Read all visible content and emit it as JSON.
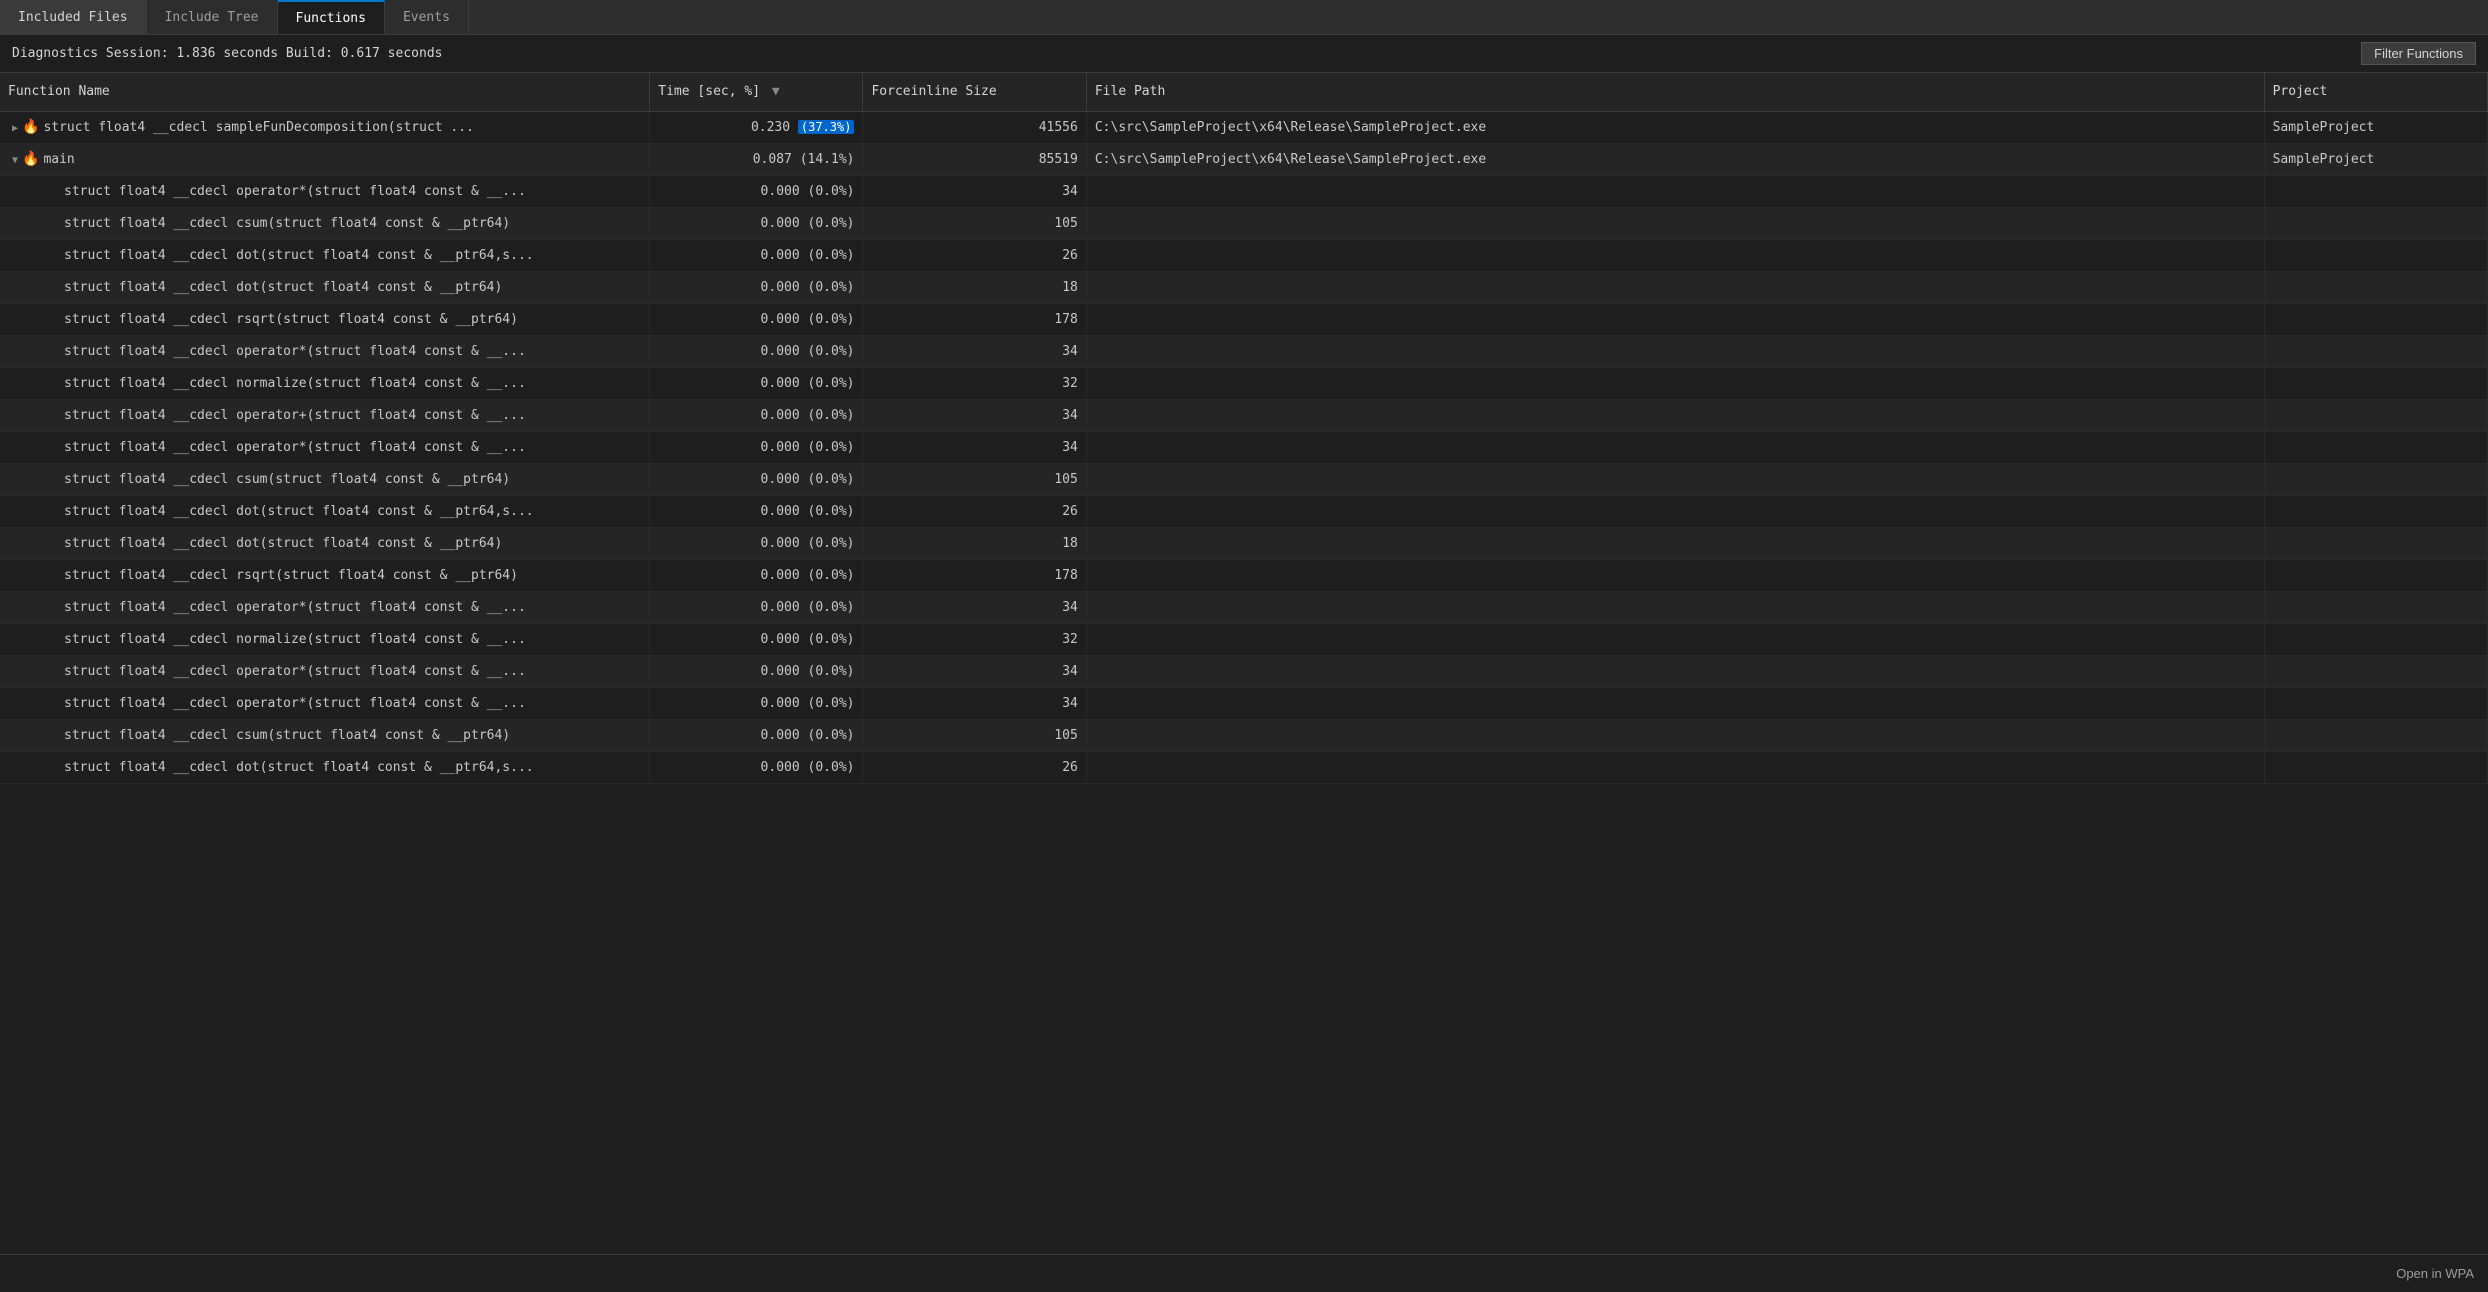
{
  "tabs": [
    {
      "id": "included-files",
      "label": "Included Files",
      "active": false
    },
    {
      "id": "include-tree",
      "label": "Include Tree",
      "active": false
    },
    {
      "id": "functions",
      "label": "Functions",
      "active": true
    },
    {
      "id": "events",
      "label": "Events",
      "active": false
    }
  ],
  "status": {
    "text": "Diagnostics Session: 1.836 seconds  Build: 0.617 seconds"
  },
  "filter_button_label": "Filter Functions",
  "open_wpa_label": "Open in WPA",
  "columns": {
    "name": "Function Name",
    "time": "Time [sec, %]",
    "force": "Forceinline Size",
    "path": "File Path",
    "project": "Project"
  },
  "rows": [
    {
      "indent": 0,
      "expandable": true,
      "expanded": false,
      "has_fire": true,
      "name": "struct float4 __cdecl sampleFunDecomposition(struct ...",
      "time_val": "0.230",
      "time_pct": "37.3%",
      "time_pct_highlight": true,
      "force": "41556",
      "path": "C:\\src\\SampleProject\\x64\\Release\\SampleProject.exe",
      "project": "SampleProject"
    },
    {
      "indent": 0,
      "expandable": true,
      "expanded": true,
      "has_fire": true,
      "name": "main",
      "time_val": "0.087",
      "time_pct": "14.1%",
      "time_pct_highlight": false,
      "force": "85519",
      "path": "C:\\src\\SampleProject\\x64\\Release\\SampleProject.exe",
      "project": "SampleProject"
    },
    {
      "indent": 1,
      "expandable": false,
      "expanded": false,
      "has_fire": false,
      "name": "struct float4 __cdecl operator*(struct float4 const & __...",
      "time_val": "0.000",
      "time_pct": "0.0%",
      "time_pct_highlight": false,
      "force": "34",
      "path": "",
      "project": ""
    },
    {
      "indent": 1,
      "expandable": false,
      "expanded": false,
      "has_fire": false,
      "name": "struct float4 __cdecl csum(struct float4 const & __ptr64)",
      "time_val": "0.000",
      "time_pct": "0.0%",
      "time_pct_highlight": false,
      "force": "105",
      "path": "",
      "project": ""
    },
    {
      "indent": 1,
      "expandable": false,
      "expanded": false,
      "has_fire": false,
      "name": "struct float4 __cdecl dot(struct float4 const & __ptr64,s...",
      "time_val": "0.000",
      "time_pct": "0.0%",
      "time_pct_highlight": false,
      "force": "26",
      "path": "",
      "project": ""
    },
    {
      "indent": 1,
      "expandable": false,
      "expanded": false,
      "has_fire": false,
      "name": "struct float4 __cdecl dot(struct float4 const & __ptr64)",
      "time_val": "0.000",
      "time_pct": "0.0%",
      "time_pct_highlight": false,
      "force": "18",
      "path": "",
      "project": ""
    },
    {
      "indent": 1,
      "expandable": false,
      "expanded": false,
      "has_fire": false,
      "name": "struct float4 __cdecl rsqrt(struct float4 const & __ptr64)",
      "time_val": "0.000",
      "time_pct": "0.0%",
      "time_pct_highlight": false,
      "force": "178",
      "path": "",
      "project": ""
    },
    {
      "indent": 1,
      "expandable": false,
      "expanded": false,
      "has_fire": false,
      "name": "struct float4 __cdecl operator*(struct float4 const & __...",
      "time_val": "0.000",
      "time_pct": "0.0%",
      "time_pct_highlight": false,
      "force": "34",
      "path": "",
      "project": ""
    },
    {
      "indent": 1,
      "expandable": false,
      "expanded": false,
      "has_fire": false,
      "name": "struct float4 __cdecl normalize(struct float4 const & __...",
      "time_val": "0.000",
      "time_pct": "0.0%",
      "time_pct_highlight": false,
      "force": "32",
      "path": "",
      "project": ""
    },
    {
      "indent": 1,
      "expandable": false,
      "expanded": false,
      "has_fire": false,
      "name": "struct float4 __cdecl operator+(struct float4 const & __...",
      "time_val": "0.000",
      "time_pct": "0.0%",
      "time_pct_highlight": false,
      "force": "34",
      "path": "",
      "project": ""
    },
    {
      "indent": 1,
      "expandable": false,
      "expanded": false,
      "has_fire": false,
      "name": "struct float4 __cdecl operator*(struct float4 const & __...",
      "time_val": "0.000",
      "time_pct": "0.0%",
      "time_pct_highlight": false,
      "force": "34",
      "path": "",
      "project": ""
    },
    {
      "indent": 1,
      "expandable": false,
      "expanded": false,
      "has_fire": false,
      "name": "struct float4 __cdecl csum(struct float4 const & __ptr64)",
      "time_val": "0.000",
      "time_pct": "0.0%",
      "time_pct_highlight": false,
      "force": "105",
      "path": "",
      "project": ""
    },
    {
      "indent": 1,
      "expandable": false,
      "expanded": false,
      "has_fire": false,
      "name": "struct float4 __cdecl dot(struct float4 const & __ptr64,s...",
      "time_val": "0.000",
      "time_pct": "0.0%",
      "time_pct_highlight": false,
      "force": "26",
      "path": "",
      "project": ""
    },
    {
      "indent": 1,
      "expandable": false,
      "expanded": false,
      "has_fire": false,
      "name": "struct float4 __cdecl dot(struct float4 const & __ptr64)",
      "time_val": "0.000",
      "time_pct": "0.0%",
      "time_pct_highlight": false,
      "force": "18",
      "path": "",
      "project": ""
    },
    {
      "indent": 1,
      "expandable": false,
      "expanded": false,
      "has_fire": false,
      "name": "struct float4 __cdecl rsqrt(struct float4 const & __ptr64)",
      "time_val": "0.000",
      "time_pct": "0.0%",
      "time_pct_highlight": false,
      "force": "178",
      "path": "",
      "project": ""
    },
    {
      "indent": 1,
      "expandable": false,
      "expanded": false,
      "has_fire": false,
      "name": "struct float4 __cdecl operator*(struct float4 const & __...",
      "time_val": "0.000",
      "time_pct": "0.0%",
      "time_pct_highlight": false,
      "force": "34",
      "path": "",
      "project": ""
    },
    {
      "indent": 1,
      "expandable": false,
      "expanded": false,
      "has_fire": false,
      "name": "struct float4 __cdecl normalize(struct float4 const & __...",
      "time_val": "0.000",
      "time_pct": "0.0%",
      "time_pct_highlight": false,
      "force": "32",
      "path": "",
      "project": ""
    },
    {
      "indent": 1,
      "expandable": false,
      "expanded": false,
      "has_fire": false,
      "name": "struct float4 __cdecl operator*(struct float4 const & __...",
      "time_val": "0.000",
      "time_pct": "0.0%",
      "time_pct_highlight": false,
      "force": "34",
      "path": "",
      "project": ""
    },
    {
      "indent": 1,
      "expandable": false,
      "expanded": false,
      "has_fire": false,
      "name": "struct float4 __cdecl operator*(struct float4 const & __...",
      "time_val": "0.000",
      "time_pct": "0.0%",
      "time_pct_highlight": false,
      "force": "34",
      "path": "",
      "project": ""
    },
    {
      "indent": 1,
      "expandable": false,
      "expanded": false,
      "has_fire": false,
      "name": "struct float4 __cdecl csum(struct float4 const & __ptr64)",
      "time_val": "0.000",
      "time_pct": "0.0%",
      "time_pct_highlight": false,
      "force": "105",
      "path": "",
      "project": ""
    },
    {
      "indent": 1,
      "expandable": false,
      "expanded": false,
      "has_fire": false,
      "name": "struct float4 __cdecl dot(struct float4 const & __ptr64,s...",
      "time_val": "0.000",
      "time_pct": "0.0%",
      "time_pct_highlight": false,
      "force": "26",
      "path": "",
      "project": ""
    }
  ]
}
